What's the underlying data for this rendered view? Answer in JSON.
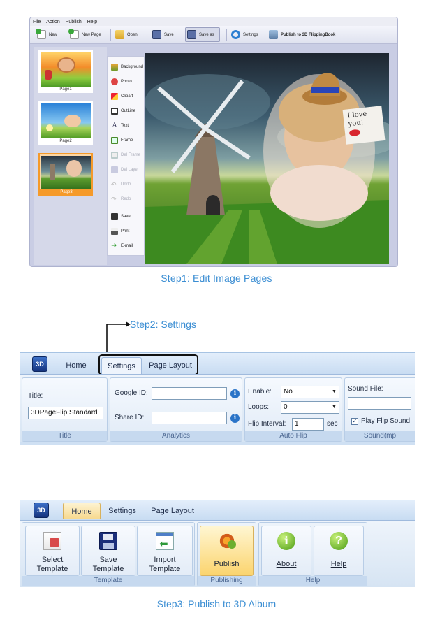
{
  "step1": {
    "menu": [
      "File",
      "Action",
      "Publish",
      "Help"
    ],
    "toolbar": {
      "new": "New",
      "new_page": "New Page",
      "open": "Open",
      "save": "Save",
      "save_as": "Save as",
      "settings": "Settings",
      "publish": "Publish to 3D FlippingBook"
    },
    "pages": [
      "Page1",
      "Page2",
      "Page3"
    ],
    "selected_page": "Page3",
    "tools": {
      "background": "Background",
      "photo": "Photo",
      "clipart": "Clipart",
      "outline": "OutLine",
      "text": "Text",
      "frame": "Frame",
      "del_frame": "Del Frame",
      "del_layer": "Del Layer",
      "undo": "Undo",
      "redo": "Redo",
      "save": "Save",
      "print": "Print",
      "email": "E-mail"
    },
    "note_text": "I love you!",
    "caption": "Step1: Edit Image Pages"
  },
  "step2": {
    "caption": "Step2: Settings",
    "app_button": "3D",
    "tabs": {
      "home": "Home",
      "settings": "Settings",
      "page_layout": "Page Layout"
    },
    "title_group": {
      "label": "Title:",
      "value": "3DPageFlip Standard",
      "group": "Title"
    },
    "analytics": {
      "google_label": "Google ID:",
      "share_label": "Share ID:",
      "google_value": "",
      "share_value": "",
      "group": "Analytics"
    },
    "autoflip": {
      "enable_label": "Enable:",
      "enable_value": "No",
      "loops_label": "Loops:",
      "loops_value": "0",
      "interval_label": "Flip Interval:",
      "interval_value": "1",
      "unit": "sec",
      "group": "Auto Flip"
    },
    "sound": {
      "label": "Sound File:",
      "value": "",
      "play_label": "Play Flip Sound",
      "group": "Sound(mp"
    }
  },
  "step3": {
    "caption": "Step3: Publish to 3D Album",
    "app_button": "3D",
    "tabs": {
      "home": "Home",
      "settings": "Settings",
      "page_layout": "Page Layout"
    },
    "buttons": {
      "select_1": "Select",
      "select_2": "Template",
      "save_1": "Save",
      "save_2": "Template",
      "import_1": "Import",
      "import_2": "Template",
      "publish": "Publish",
      "about": "About",
      "help": "Help"
    },
    "groups": {
      "template": "Template",
      "publishing": "Publishing",
      "help": "Help"
    }
  },
  "colors": {
    "accent_blue": "#3b8ed3",
    "selection_orange": "#f59a2a",
    "ribbon_blue": "#cfe0f3"
  }
}
